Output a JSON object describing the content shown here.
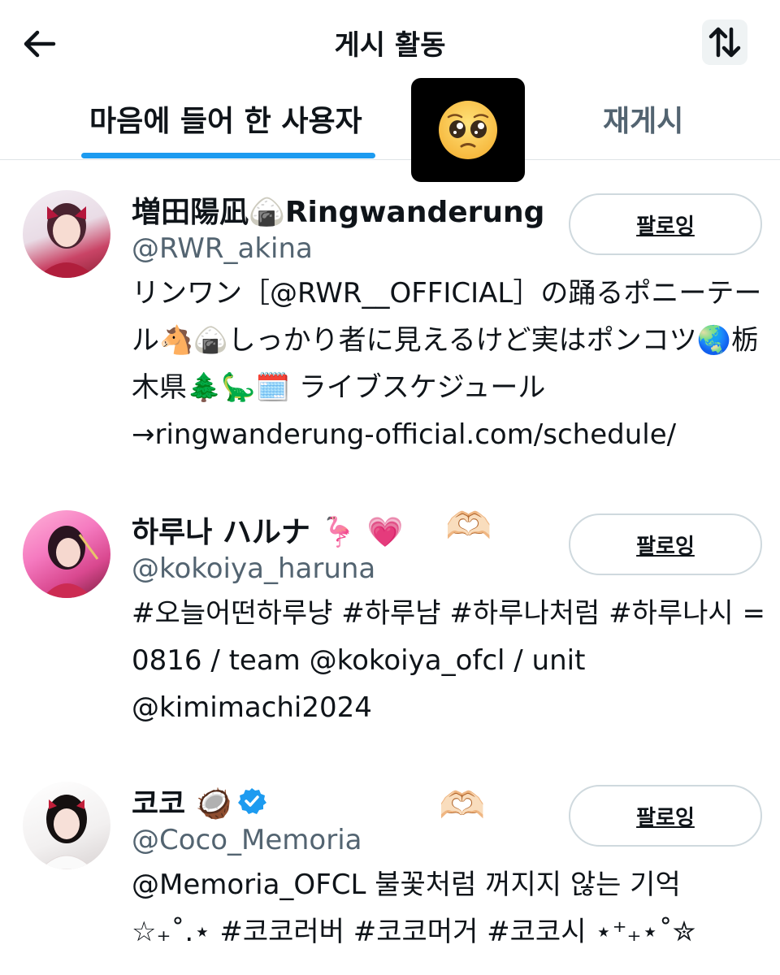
{
  "header": {
    "title": "게시 활동",
    "back_icon": "arrow-left-icon",
    "sort_icon": "sort-arrows-icon"
  },
  "tabs": [
    {
      "label": "마음에 들어 한 사용자",
      "active": true
    },
    {
      "label": "재게시",
      "active": false
    }
  ],
  "sticker": {
    "icon": "pleading-face-emoji"
  },
  "colors": {
    "accent": "#1d9bf0",
    "text": "#0f1419",
    "muted": "#536471",
    "border": "#cfd9de",
    "verified": "#1d9bf0"
  },
  "users": [
    {
      "name": "増田陽凪🍙Ringwanderung",
      "handle": "@RWR_akina",
      "bio": "リンワン［@RWR__OFFICIAL］の踊るポニーテール🐴🍙しっかり者に見えるけど実はポンコツ🌏栃木県🌲🦕🗓️ ライブスケジュール→ringwanderung-official.com/schedule/",
      "follow_label": "팔로잉"
    },
    {
      "name": "하루나 ハルナ 🦩 💗",
      "handle": "@kokoiya_haruna",
      "bio": "#오늘어떤하루냥 #하루냠 #하루나처럼 #하루나시 = 0816 / team @kokoiya_ofcl / unit @kimimachi2024",
      "follow_label": "팔로잉",
      "decoration": "🫶🏻"
    },
    {
      "name": "코코 🥥",
      "handle": "@Coco_Memoria",
      "bio": "@Memoria_OFCL 불꽃처럼 꺼지지 않는 기억 ☆₊˚.⋆ #코코러버 #코코머거 #코코시 ⋆⁺₊⋆˚✮",
      "follow_label": "팔로잉",
      "verified": true,
      "decoration": "🫶🏻"
    }
  ]
}
